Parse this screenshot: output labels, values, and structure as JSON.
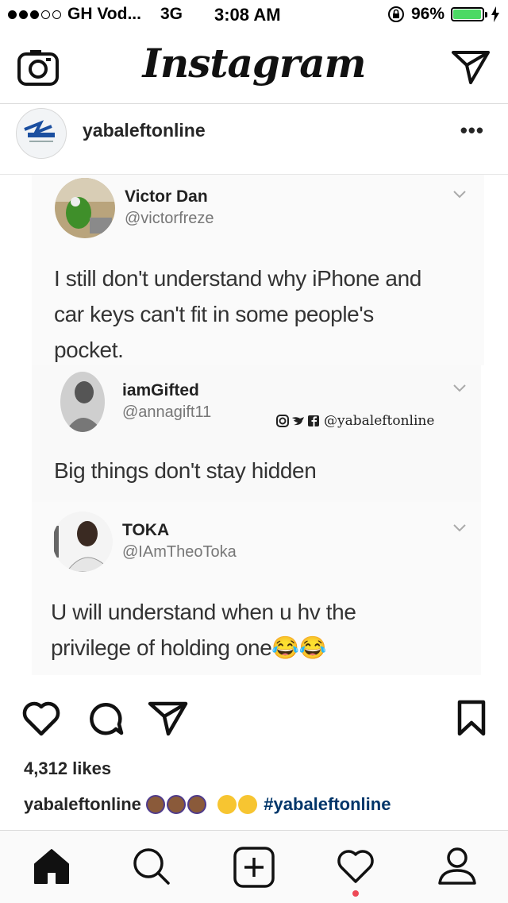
{
  "status_bar": {
    "carrier": "GH Vod...",
    "network": "3G",
    "time": "3:08 AM",
    "battery": "96%",
    "battery_level": 0.96
  },
  "header": {
    "logo": "Instagram"
  },
  "post": {
    "username": "yabaleftonline",
    "more_label": "•••",
    "tweets": [
      {
        "name": "Victor Dan",
        "handle": "@victorfreze",
        "lines": [
          "I still don't understand why iPhone and",
          "car keys can't fit in some people's",
          "pocket."
        ]
      },
      {
        "name": "iamGifted",
        "handle": "@annagift11",
        "lines": [
          "Big things don't stay hidden"
        ]
      },
      {
        "name": "TOKA",
        "handle": "@IAmTheoToka",
        "lines": [
          "U will understand when u hv the",
          "privilege of holding one😂😂"
        ]
      }
    ],
    "watermark": "@yabaleftonline",
    "likes": "4,312 likes",
    "caption_user": "yabaleftonline",
    "caption_hashtag": "#yabaleftonline"
  },
  "colors": {
    "hashtag": "#003569",
    "notification_dot": "#ed4956",
    "battery_green": "#4cd964"
  }
}
